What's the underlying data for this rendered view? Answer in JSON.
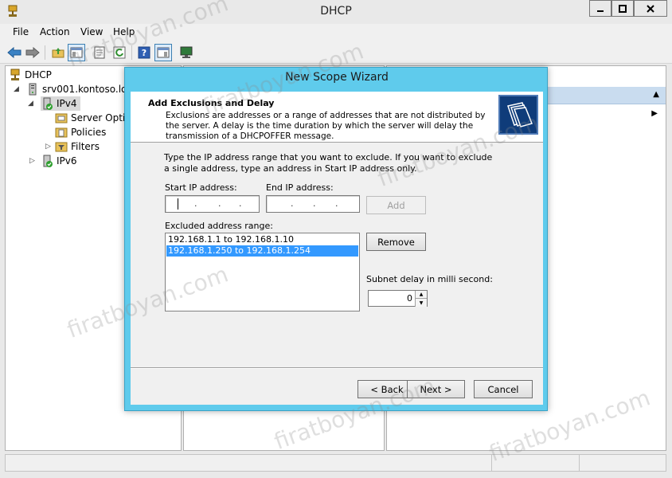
{
  "window": {
    "title": "DHCP",
    "controls": [
      "minimize",
      "maximize",
      "close"
    ]
  },
  "menu": [
    "File",
    "Action",
    "View",
    "Help"
  ],
  "toolbar": {
    "icons": [
      "back-arrow-icon",
      "forward-arrow-icon",
      "up-folder-icon",
      "show-hide-tree-icon",
      "properties-icon",
      "refresh-icon",
      "help-icon",
      "action-pane-icon",
      "monitor-icon"
    ]
  },
  "tree": {
    "root": "DHCP",
    "server": "srv001.kontoso.loca",
    "ipv4": "IPv4",
    "server_options": "Server Options",
    "policies": "Policies",
    "filters": "Filters",
    "ipv6": "IPv6"
  },
  "wizard": {
    "title": "New Scope Wizard",
    "header_title": "Add Exclusions and Delay",
    "header_desc": "Exclusions are addresses or a range of addresses that are not distributed by the server. A delay is the time duration by which the server will delay the transmission of a DHCPOFFER message.",
    "instruction": "Type the IP address range that you want to exclude. If you want to exclude a single address, type an address in Start IP address only.",
    "start_ip_label": "Start IP address:",
    "end_ip_label": "End IP address:",
    "add_label": "Add",
    "excluded_label": "Excluded address range:",
    "excluded_ranges": [
      "192.168.1.1 to 192.168.1.10",
      "192.168.1.250 to 192.168.1.254"
    ],
    "selected_index": 1,
    "remove_label": "Remove",
    "delay_label": "Subnet delay in milli second:",
    "delay_value": "0",
    "back_label": "< Back",
    "next_label": "Next >",
    "cancel_label": "Cancel"
  },
  "watermark": "firatboyan.com",
  "colors": {
    "wizard_frame": "#5fcbec",
    "selection": "#3399ff",
    "actions_header": "#c9dcef"
  }
}
